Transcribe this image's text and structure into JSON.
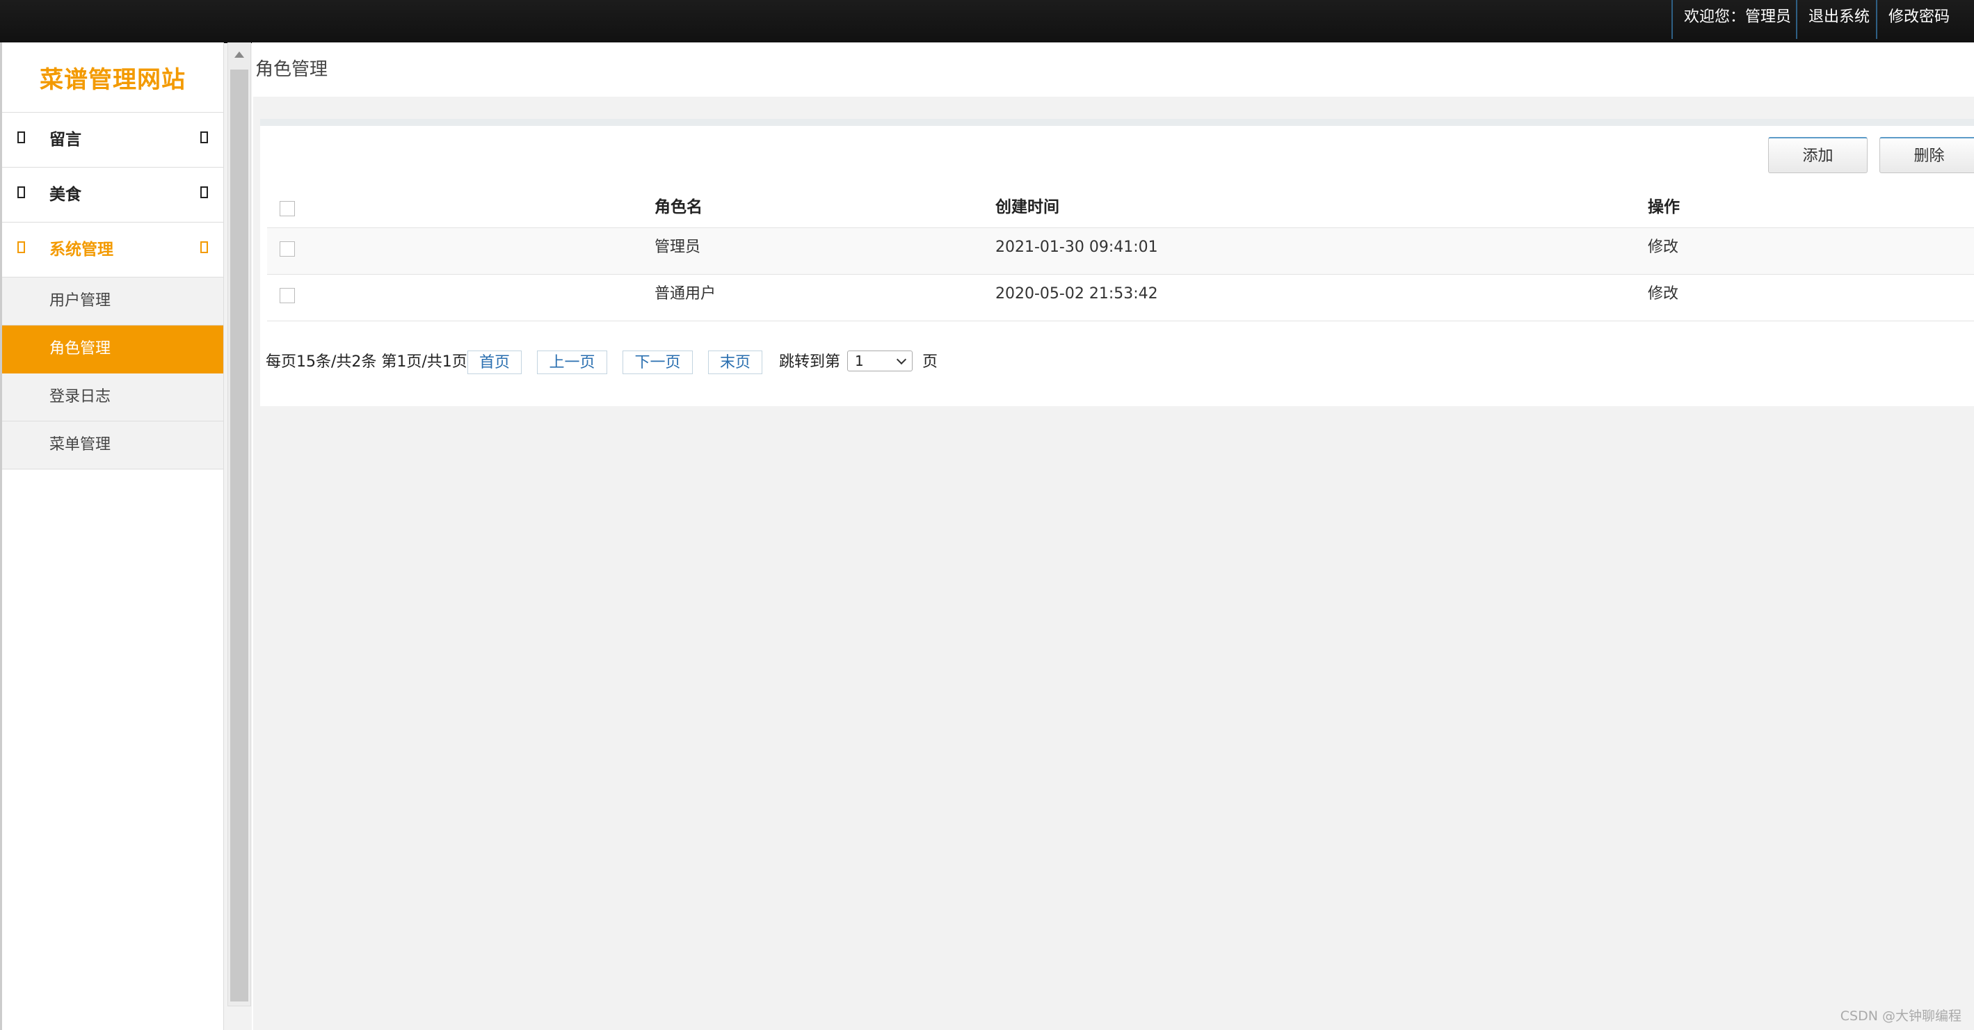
{
  "topbar": {
    "welcome": "欢迎您：管理员",
    "logout": "退出系统",
    "change_password": "修改密码"
  },
  "sidebar": {
    "logo": "菜谱管理网站",
    "groups": [
      {
        "label": "留言",
        "icon": "square-icon"
      },
      {
        "label": "美食",
        "icon": "square-icon"
      },
      {
        "label": "系统管理",
        "icon": "square-icon",
        "active": true
      }
    ],
    "sub_items": [
      {
        "label": "用户管理"
      },
      {
        "label": "角色管理",
        "selected": true
      },
      {
        "label": "登录日志"
      },
      {
        "label": "菜单管理"
      }
    ]
  },
  "main": {
    "title": "角色管理",
    "toolbar": {
      "add": "添加",
      "delete": "删除"
    },
    "table": {
      "headers": {
        "name": "角色名",
        "created": "创建时间",
        "action": "操作"
      },
      "rows": [
        {
          "name": "管理员",
          "created": "2021-01-30 09:41:01",
          "action": "修改"
        },
        {
          "name": "普通用户",
          "created": "2020-05-02 21:53:42",
          "action": "修改"
        }
      ]
    },
    "pager": {
      "info": "每页15条/共2条 第1页/共1页",
      "first": "首页",
      "prev": "上一页",
      "next": "下一页",
      "last": "末页",
      "jump_prefix": "跳转到第",
      "jump_value": "1",
      "jump_suffix": "页"
    }
  },
  "watermark": "CSDN @大钟聊编程",
  "colors": {
    "accent": "#f39a00",
    "topbar": "#151515",
    "link": "#2a6fb0"
  }
}
